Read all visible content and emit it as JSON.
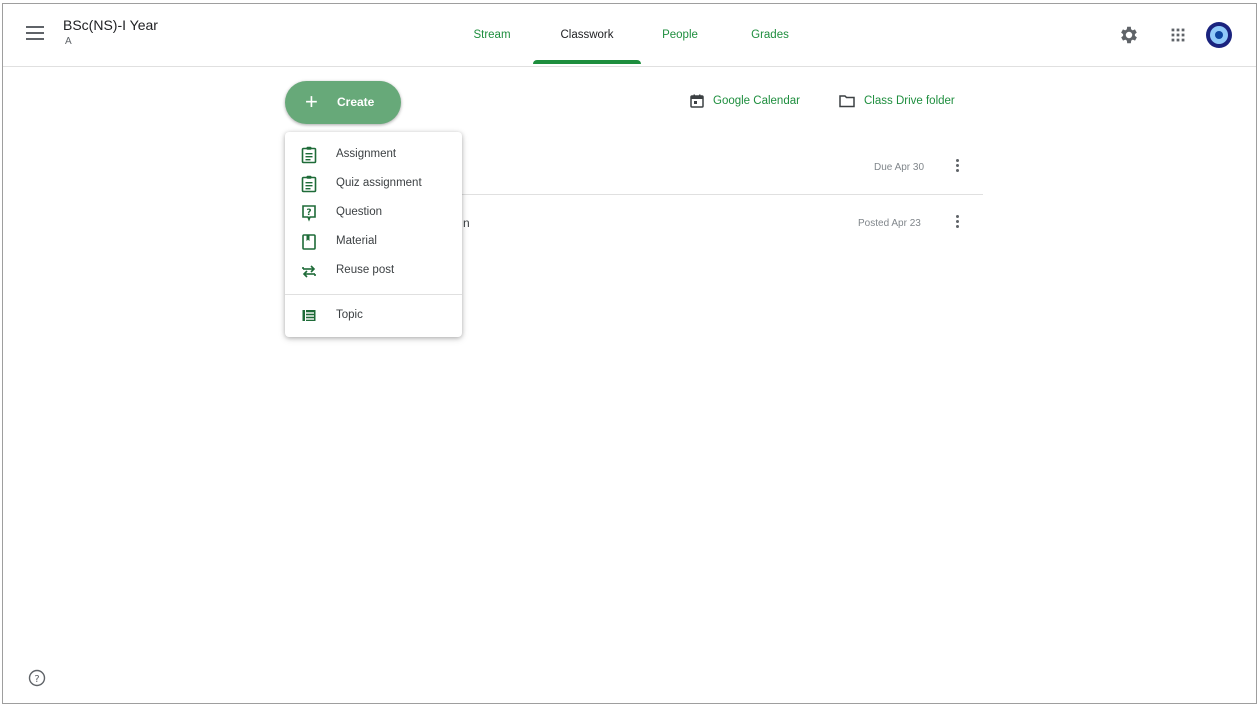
{
  "header": {
    "class_name": "BSc(NS)-I Year",
    "section": "A",
    "tabs": [
      {
        "label": "Stream"
      },
      {
        "label": "Classwork"
      },
      {
        "label": "People"
      },
      {
        "label": "Grades"
      }
    ],
    "active_tab": "Classwork",
    "icons": [
      "menu-icon",
      "gear-icon",
      "apps-grid-icon",
      "avatar"
    ]
  },
  "toolbar": {
    "create_label": "Create",
    "calendar_label": "Google Calendar",
    "drive_label": "Class Drive folder"
  },
  "classwork": {
    "rows": [
      {
        "title_fragment": "",
        "meta": "Due Apr 30"
      },
      {
        "title_fragment": "n",
        "meta": "Posted Apr 23"
      }
    ]
  },
  "create_menu": {
    "items": [
      {
        "label": "Assignment",
        "icon": "assignment-icon"
      },
      {
        "label": "Quiz assignment",
        "icon": "quiz-assignment-icon"
      },
      {
        "label": "Question",
        "icon": "question-icon"
      },
      {
        "label": "Material",
        "icon": "material-icon"
      },
      {
        "label": "Reuse post",
        "icon": "reuse-post-icon"
      }
    ],
    "topic": {
      "label": "Topic",
      "icon": "topic-icon"
    }
  },
  "colors": {
    "accent_green": "#1e8e3e",
    "create_button": "#67a979"
  }
}
